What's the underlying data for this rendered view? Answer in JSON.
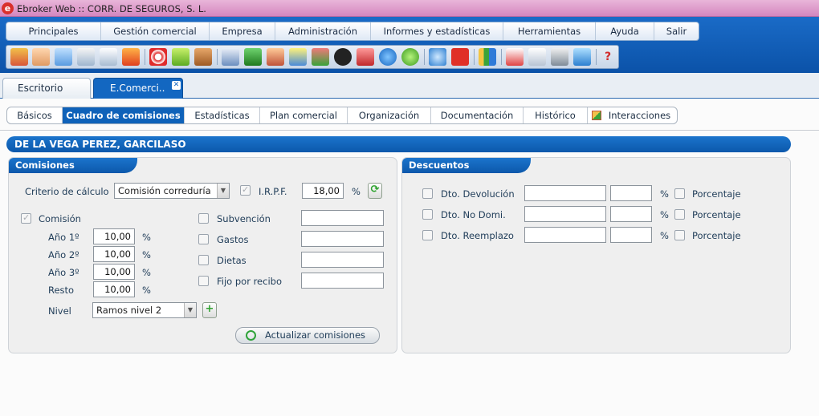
{
  "window": {
    "app_icon": "e",
    "title": "Ebroker Web :: CORR. DE SEGUROS, S. L."
  },
  "menu": [
    "Principales",
    "Gestión comercial",
    "Empresa",
    "Administración",
    "Informes y estadísticas",
    "Herramientas",
    "Ayuda",
    "Salir"
  ],
  "toolbar_icons": [
    "boxes-icon",
    "user-card-icon",
    "person-icon",
    "id-card-icon",
    "window-icon",
    "fire-icon",
    "target-icon",
    "eraser-icon",
    "briefcase-icon",
    "envelope-icon",
    "building-icon",
    "agent-icon",
    "bulb-person-icon",
    "cards-icon",
    "euro-dark-icon",
    "group-icon",
    "euro-blue-icon",
    "euro-green-icon",
    "refresh-icon",
    "g-icon",
    "chart-icon",
    "eye-card-icon",
    "notes-icon",
    "calculator-icon",
    "link-icon",
    "help-icon"
  ],
  "tabs": {
    "escritorio": "Escritorio",
    "ecomerci": "E.Comerci.."
  },
  "subtabs": [
    "Básicos",
    "Cuadro de comisiones",
    "Estadísticas",
    "Plan comercial",
    "Organización",
    "Documentación",
    "Histórico",
    "Interacciones"
  ],
  "client_name": "DE LA VEGA PEREZ, GARCILASO",
  "comisiones": {
    "title": "Comisiones",
    "criterio_label": "Criterio de cálculo",
    "criterio_value": "Comisión correduría",
    "irpf_label": "I.R.P.F.",
    "irpf_value": "18,00",
    "percent": "%",
    "comision_label": "Comisión",
    "years": [
      {
        "label": "Año 1º",
        "value": "10,00"
      },
      {
        "label": "Año 2º",
        "value": "10,00"
      },
      {
        "label": "Año 3º",
        "value": "10,00"
      },
      {
        "label": "Resto",
        "value": "10,00"
      }
    ],
    "options": [
      "Subvención",
      "Gastos",
      "Dietas",
      "Fijo por recibo"
    ],
    "nivel_label": "Nivel",
    "nivel_value": "Ramos nivel 2",
    "update_button": "Actualizar comisiones"
  },
  "descuentos": {
    "title": "Descuentos",
    "rows": [
      "Dto. Devolución",
      "Dto. No Domi.",
      "Dto. Reemplazo"
    ],
    "percent": "%",
    "porcentaje_label": "Porcentaje"
  }
}
